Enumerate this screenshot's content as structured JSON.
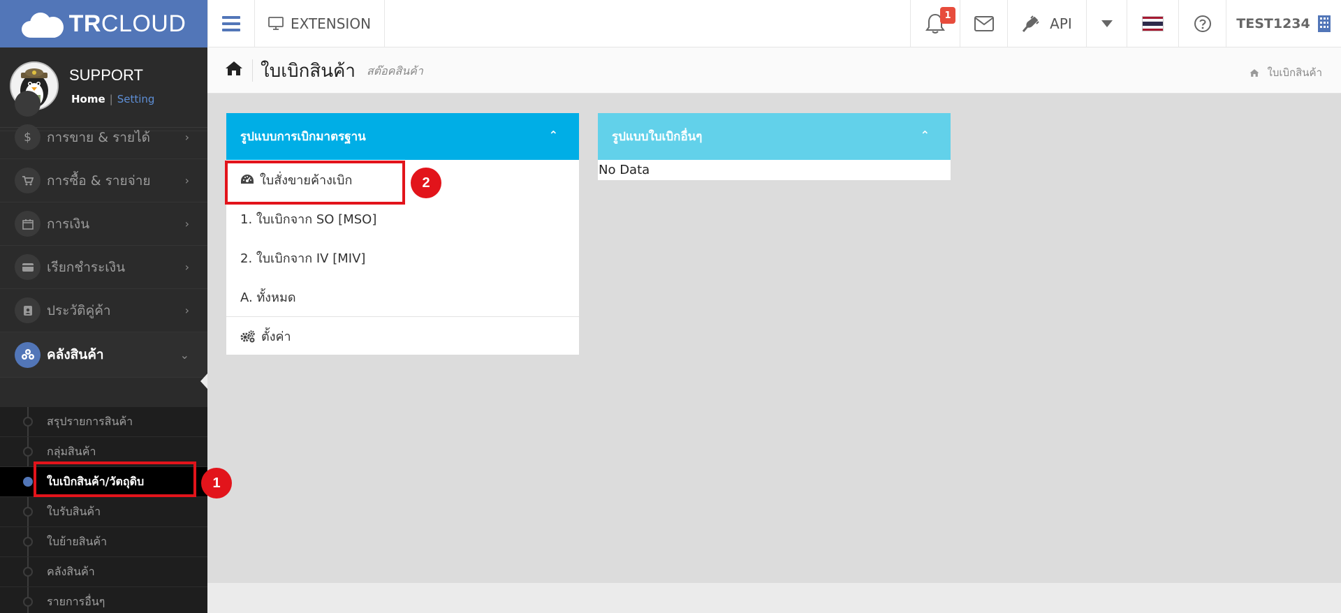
{
  "topbar": {
    "brand_bold": "TR",
    "brand_rest": "CLOUD",
    "extension_label": "EXTENSION",
    "notification_count": "1",
    "api_label": "API",
    "username": "TEST1234",
    "flag_colors": [
      "#a51931",
      "#f4f5f8",
      "#2d2a4a",
      "#f4f5f8",
      "#a51931"
    ]
  },
  "profile": {
    "name": "SUPPORT",
    "home_link": "Home",
    "separator": "|",
    "setting_link": "Setting"
  },
  "sidebar": {
    "items": [
      {
        "label": "การขาย & รายได้",
        "icon": "dollar-icon"
      },
      {
        "label": "การซื้อ & รายจ่าย",
        "icon": "cart-icon"
      },
      {
        "label": "การเงิน",
        "icon": "calendar-icon"
      },
      {
        "label": "เรียกชำระเงิน",
        "icon": "credit-card-icon"
      },
      {
        "label": "ประวัติคู่ค้า",
        "icon": "contact-icon"
      },
      {
        "label": "คลังสินค้า",
        "icon": "cubes-icon"
      }
    ],
    "subitems": [
      "สรุปรายการสินค้า",
      "กลุ่มสินค้า",
      "ใบเบิกสินค้า/วัตถุดิบ",
      "ใบรับสินค้า",
      "ใบย้ายสินค้า",
      "คลังสินค้า",
      "รายการอื่นๆ"
    ]
  },
  "page": {
    "title": "ใบเบิกสินค้า",
    "subtitle": "สต๊อคสินค้า",
    "breadcrumb": "ใบเบิกสินค้า"
  },
  "panels": {
    "standard": {
      "title": "รูปแบบการเบิกมาตรฐาน",
      "rows": [
        "ใบสั่งขายค้างเบิก",
        "1. ใบเบิกจาก SO [MSO]",
        "2. ใบเบิกจาก IV [MIV]",
        "A. ทั้งหมด",
        "ตั้งค่า"
      ]
    },
    "other": {
      "title": "รูปแบบใบเบิกอื่นๆ",
      "empty_text": "No Data"
    }
  },
  "callouts": [
    "1",
    "2"
  ]
}
